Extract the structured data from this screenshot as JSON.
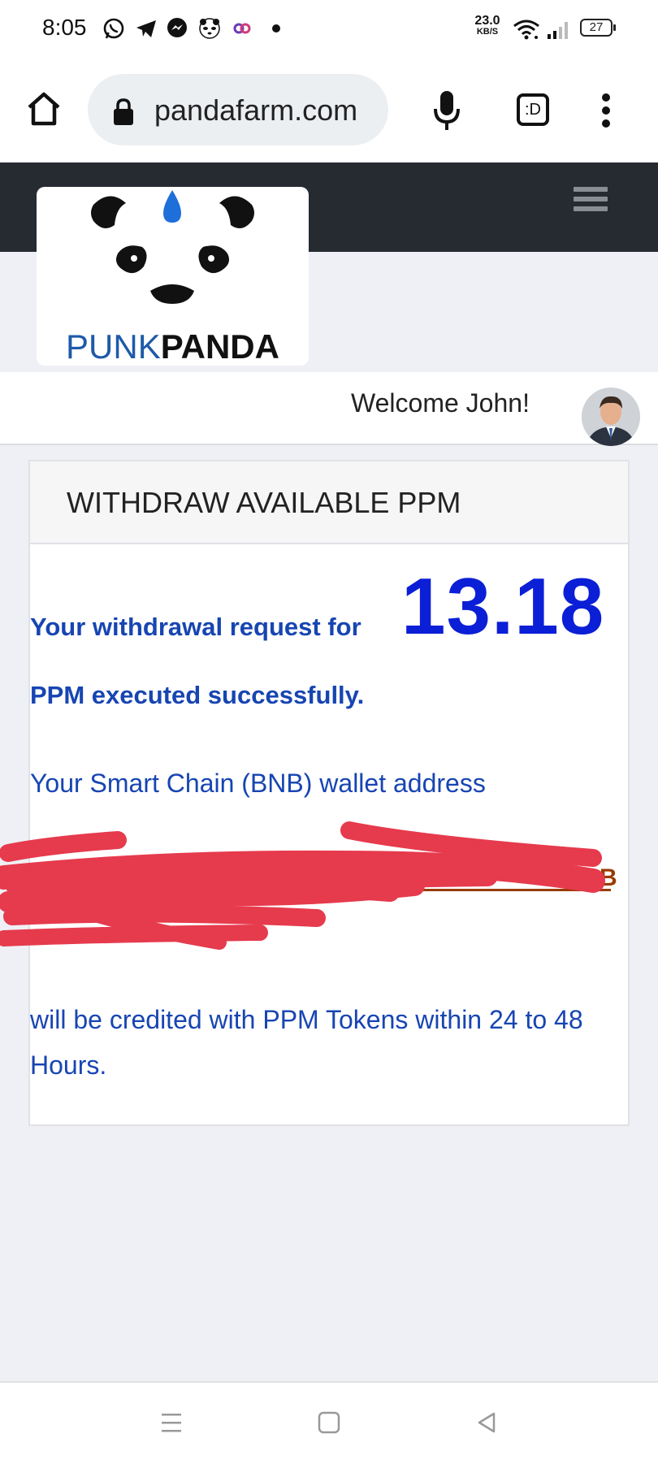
{
  "status_bar": {
    "time": "8:05",
    "net_speed_value": "23.0",
    "net_speed_unit": "KB/S",
    "battery": "27",
    "icons": [
      "whatsapp-icon",
      "telegram-icon",
      "messenger-icon",
      "panda-app-icon",
      "link-app-icon",
      "dot-icon",
      "wifi-icon",
      "signal-icon",
      "battery-icon"
    ]
  },
  "browser": {
    "url": "pandafarm.com",
    "icons": [
      "home-icon",
      "lock-icon",
      "microphone-icon",
      "tab-switcher-icon",
      "more-vertical-icon"
    ],
    "tab_switcher_label": ":D"
  },
  "site_header": {
    "brand_part1": "PUNK",
    "brand_part2": "PANDA",
    "menu_icon": "hamburger-menu-icon"
  },
  "welcome": {
    "text": "Welcome John!"
  },
  "card": {
    "title": "WITHDRAW AVAILABLE PPM",
    "success_line1": "Your withdrawal request for",
    "amount": "13.18",
    "success_line2": "PPM executed successfully.",
    "wallet_label": "Your Smart Chain (BNB) wallet address",
    "wallet_address": "",
    "credit_text": "will be credited with PPM Tokens within 24 to 48 Hours."
  },
  "colors": {
    "header_dark": "#262a31",
    "text_blue": "#1745b2",
    "amount_blue": "#0b1fd6",
    "redaction_red": "#e63a4d",
    "brand_blue": "#1e5aa8"
  },
  "nav_bar": {
    "icons": [
      "recent-apps-icon",
      "home-nav-icon",
      "back-icon"
    ]
  }
}
